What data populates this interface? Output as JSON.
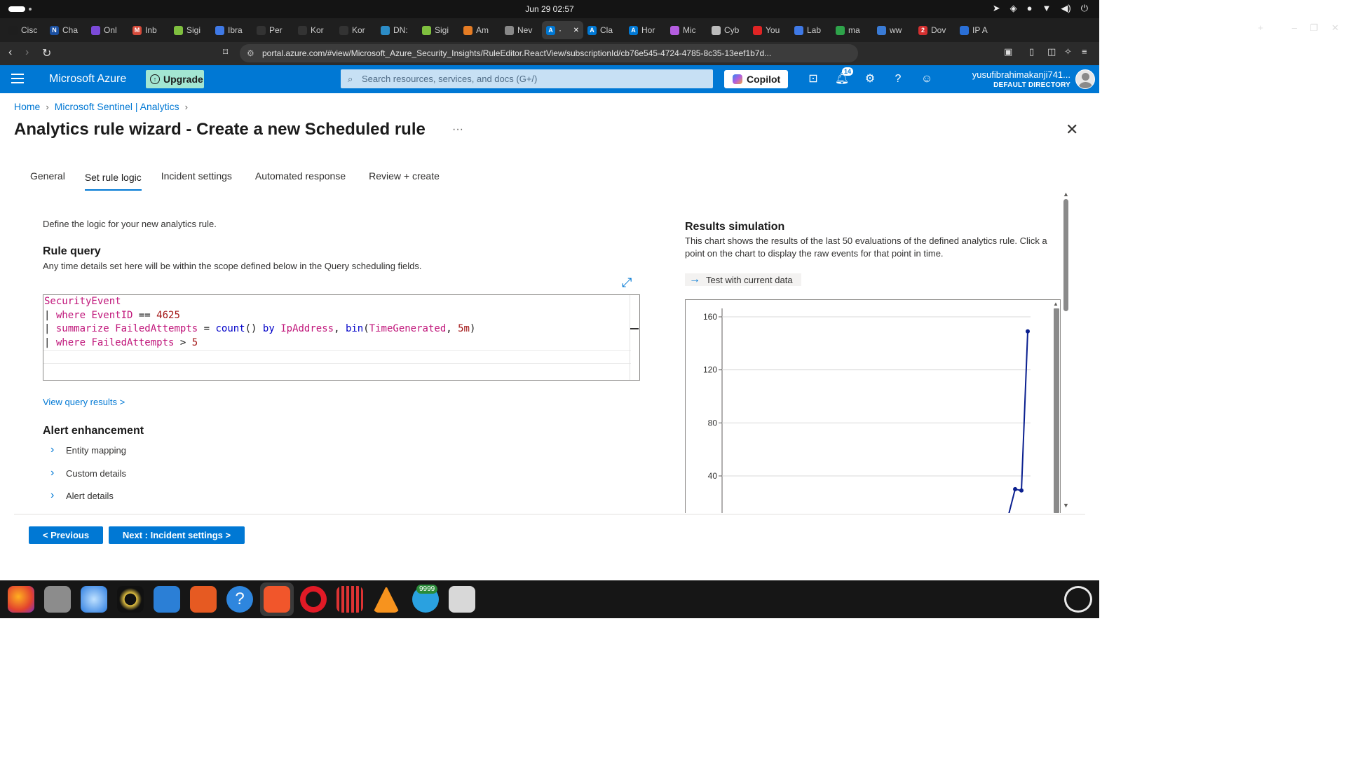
{
  "os": {
    "clock": "Jun 29  02:57"
  },
  "browser_tabs": [
    {
      "label": "Cisc",
      "color": "#1e1e1e"
    },
    {
      "label": "Cha",
      "color": "#1a4fa0",
      "glyph": "N"
    },
    {
      "label": "Onl",
      "color": "#7b4ad8"
    },
    {
      "label": "Inb",
      "color": "#d64b3b",
      "glyph": "M"
    },
    {
      "label": "Sigi",
      "color": "#7fbf3f"
    },
    {
      "label": "Ibra",
      "color": "#3f79e6"
    },
    {
      "label": "Per",
      "color": "#333"
    },
    {
      "label": "Kor",
      "color": "#333"
    },
    {
      "label": "Kor",
      "color": "#333"
    },
    {
      "label": "DN:",
      "color": "#2c8cc6"
    },
    {
      "label": "Sigi",
      "color": "#7fbf3f"
    },
    {
      "label": "Am",
      "color": "#e57c24"
    },
    {
      "label": "Nev",
      "color": "#888"
    },
    {
      "label": "·",
      "color": "#0078d4",
      "glyph": "A"
    },
    {
      "label": "Cla",
      "color": "#0078d4",
      "glyph": "A"
    },
    {
      "label": "Hor",
      "color": "#0078d4",
      "glyph": "A"
    },
    {
      "label": "Mic",
      "color": "#b45de0"
    },
    {
      "label": "Cyb",
      "color": "#bbb"
    },
    {
      "label": "You",
      "color": "#e02424"
    },
    {
      "label": "Lab",
      "color": "#3f79e6"
    },
    {
      "label": "ma",
      "color": "#2ea34a"
    },
    {
      "label": "ww",
      "color": "#3a7bd5"
    },
    {
      "label": "Dov",
      "color": "#d43030",
      "glyph": "2"
    },
    {
      "label": "IP A",
      "color": "#2a6fd6"
    }
  ],
  "address": {
    "url": "portal.azure.com/#view/Microsoft_Azure_Security_Insights/RuleEditor.ReactView/subscriptionId/cb76e545-4724-4785-8c35-13eef1b7d..."
  },
  "header": {
    "brand": "Microsoft Azure",
    "upgrade_label": "Upgrade",
    "search_placeholder": "Search resources, services, and docs (G+/)",
    "copilot_label": "Copilot",
    "notification_count": "14",
    "user_name": "yusufibrahimakanji741...",
    "user_directory": "DEFAULT DIRECTORY"
  },
  "breadcrumb": [
    "Home",
    "Microsoft Sentinel | Analytics"
  ],
  "page_title": "Analytics rule wizard - Create a new Scheduled rule",
  "wizard_tabs": [
    {
      "label": "General",
      "selected": false
    },
    {
      "label": "Set rule logic",
      "selected": true
    },
    {
      "label": "Incident settings",
      "selected": false
    },
    {
      "label": "Automated response",
      "selected": false
    },
    {
      "label": "Review + create",
      "selected": false
    }
  ],
  "rule_logic": {
    "intro": "Define the logic for your new analytics rule.",
    "rule_query_title": "Rule query",
    "rule_query_desc": "Any time details set here will be within the scope defined below in the Query scheduling fields.",
    "query_lines": [
      "SecurityEvent",
      "| where EventID == 4625",
      "| summarize FailedAttempts = count() by IpAddress, bin(TimeGenerated, 5m)",
      "| where FailedAttempts > 5"
    ],
    "view_query_results": "View query results >",
    "alert_enhancement_title": "Alert enhancement",
    "alert_items": [
      "Entity mapping",
      "Custom details",
      "Alert details"
    ]
  },
  "results_simulation": {
    "title": "Results simulation",
    "description": "This chart shows the results of the last 50 evaluations of the defined analytics rule. Click a point on the chart to display the raw events for that point in time.",
    "test_button": "Test with current data"
  },
  "chart_data": {
    "type": "line",
    "y_ticks": [
      40,
      80,
      120,
      160
    ],
    "ylim": [
      0,
      165
    ],
    "grid": true,
    "series": [
      {
        "color": "#0a1f8f",
        "points": [
          {
            "x": 47,
            "y": 0
          },
          {
            "x": 48,
            "y": 30
          },
          {
            "x": 49,
            "y": 29
          },
          {
            "x": 50,
            "y": 149
          }
        ]
      }
    ],
    "x_count": 50
  },
  "footer": {
    "previous_label": "< Previous",
    "next_label": "Next : Incident settings >"
  },
  "dock": {
    "telegram_badge": "9999"
  }
}
